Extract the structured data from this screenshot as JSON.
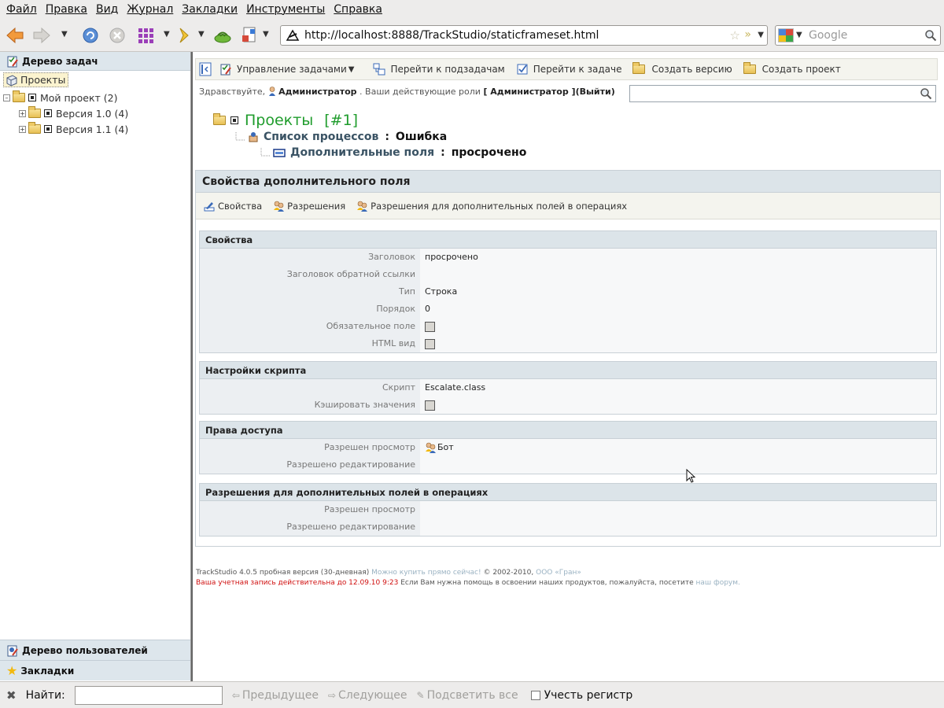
{
  "browser": {
    "menu": [
      "Файл",
      "Правка",
      "Вид",
      "Журнал",
      "Закладки",
      "Инструменты",
      "Справка"
    ],
    "url": "http://localhost:8888/TrackStudio/staticframeset.html",
    "search_placeholder": "Google"
  },
  "left_panel": {
    "title": "Дерево задач",
    "tree": {
      "root": "Проекты",
      "project": "Мой проект (2)",
      "versions": [
        "Версия 1.0 (4)",
        "Версия 1.1 (4)"
      ]
    },
    "bottom_items": [
      "Дерево пользователей",
      "Закладки"
    ]
  },
  "toolbar": {
    "manage": "Управление задачами",
    "subtasks": "Перейти к подзадачам",
    "to_task": "Перейти к задаче",
    "create_version": "Создать версию",
    "create_project": "Создать проект"
  },
  "greeting": {
    "prefix": "Здравствуйте,",
    "user": "Администратор",
    "roles_text": ". Ваши действующие роли",
    "role": "[ Администратор ]",
    "logout_open": "(",
    "logout": "Выйти",
    "logout_close": ")"
  },
  "breadcrumbs": {
    "level1": "Проекты",
    "level1_num": "[#1]",
    "level2_label": "Список процессов",
    "level2_value": "Ошибка",
    "level3_label": "Дополнительные поля",
    "level3_value": "просрочено",
    "separator": ":"
  },
  "panel": {
    "title": "Свойства дополнительного поля",
    "tabs": [
      "Свойства",
      "Разрешения",
      "Разрешения для дополнительных полей в операциях"
    ]
  },
  "sections": {
    "properties": {
      "title": "Свойства",
      "rows": [
        {
          "label": "Заголовок",
          "value": "просрочено"
        },
        {
          "label": "Заголовок обратной ссылки",
          "value": ""
        },
        {
          "label": "Тип",
          "value": "Строка"
        },
        {
          "label": "Порядок",
          "value": "0"
        },
        {
          "label": "Обязательное поле",
          "checked": false
        },
        {
          "label": "HTML вид",
          "checked": false
        }
      ]
    },
    "script": {
      "title": "Настройки скрипта",
      "rows": [
        {
          "label": "Скрипт",
          "value": "Escalate.class"
        },
        {
          "label": "Кэшировать значения",
          "checked": false
        }
      ]
    },
    "access": {
      "title": "Права доступа",
      "rows": [
        {
          "label": "Разрешен просмотр",
          "value": "Бот"
        },
        {
          "label": "Разрешено редактирование",
          "value": ""
        }
      ]
    },
    "ops": {
      "title": "Разрешения для дополнительных полей в операциях",
      "rows": [
        {
          "label": "Разрешен просмотр",
          "value": ""
        },
        {
          "label": "Разрешено редактирование",
          "value": ""
        }
      ]
    }
  },
  "footer": {
    "line1_a": "TrackStudio 4.0.5 пробная версия (30-дневная)",
    "line1_link": "Можно купить прямо сейчас!",
    "line1_b": "© 2002-2010,",
    "line1_company": "ООО «Гран»",
    "line2_red": "Ваша учетная запись действительна до 12.09.10 9:23",
    "line2_text": "Если Вам нужна помощь в освоении наших продуктов, пожалуйста, посетите",
    "line2_link": "наш форум."
  },
  "findbar": {
    "label": "Найти:",
    "prev": "Предыдущее",
    "next": "Следующее",
    "highlight": "Подсветить все",
    "match_case": "Учесть регистр"
  },
  "colors": {
    "header_bg": "#dce4e9",
    "crumb_green": "#1f9c2c",
    "label_blue": "#3a5364",
    "expiry_red": "#d01010"
  },
  "icons": [
    "back-arrow-icon",
    "forward-arrow-icon",
    "reload-icon",
    "stop-icon",
    "grid-icon",
    "home-icon",
    "feed-icon",
    "folder-icon",
    "star-icon",
    "magnifier-icon",
    "user-icon",
    "users-icon",
    "checklist-icon",
    "edit-icon",
    "close-icon"
  ]
}
